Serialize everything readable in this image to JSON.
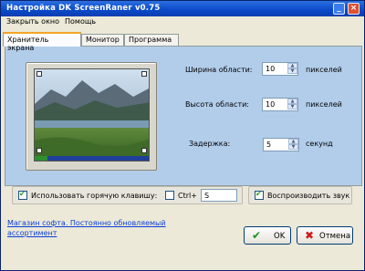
{
  "window": {
    "title": "Настройка DK ScreenRaner v0.75",
    "controls": {
      "minimize": "_",
      "close": "×"
    }
  },
  "menu": {
    "items": [
      {
        "label": "Закрыть окно"
      },
      {
        "label": "Помощь"
      }
    ]
  },
  "tabs": [
    {
      "label": "Хранитель экрана",
      "active": true
    },
    {
      "label": "Монитор",
      "active": false
    },
    {
      "label": "Программа",
      "active": false
    }
  ],
  "settings": {
    "width": {
      "label": "Ширина области:",
      "value": "10",
      "unit": "пикселей"
    },
    "height": {
      "label": "Высота области:",
      "value": "10",
      "unit": "пикселей"
    },
    "delay": {
      "label": "Задержка:",
      "value": "5",
      "unit": "секунд"
    }
  },
  "hotkey": {
    "use_label": "Использовать горячую клавишу:",
    "use_checked": true,
    "ctrl_label": "Ctrl+",
    "ctrl_checked": false,
    "key_value": "S"
  },
  "sound": {
    "label": "Воспроизводить звук",
    "checked": true
  },
  "footer": {
    "link_text": "Магазин софта. Постоянно обновляемый ассортимент"
  },
  "buttons": {
    "ok": {
      "label": "OK",
      "icon": "check-icon"
    },
    "cancel": {
      "label": "Отмена",
      "icon": "cross-icon"
    }
  },
  "colors": {
    "title_bar": "#0a49c9",
    "panel_bg": "#b2cdea",
    "window_bg": "#ece9d8",
    "link": "#0b3fd6",
    "ok_icon": "#1f8f1f",
    "cancel_icon": "#d21a1a"
  }
}
